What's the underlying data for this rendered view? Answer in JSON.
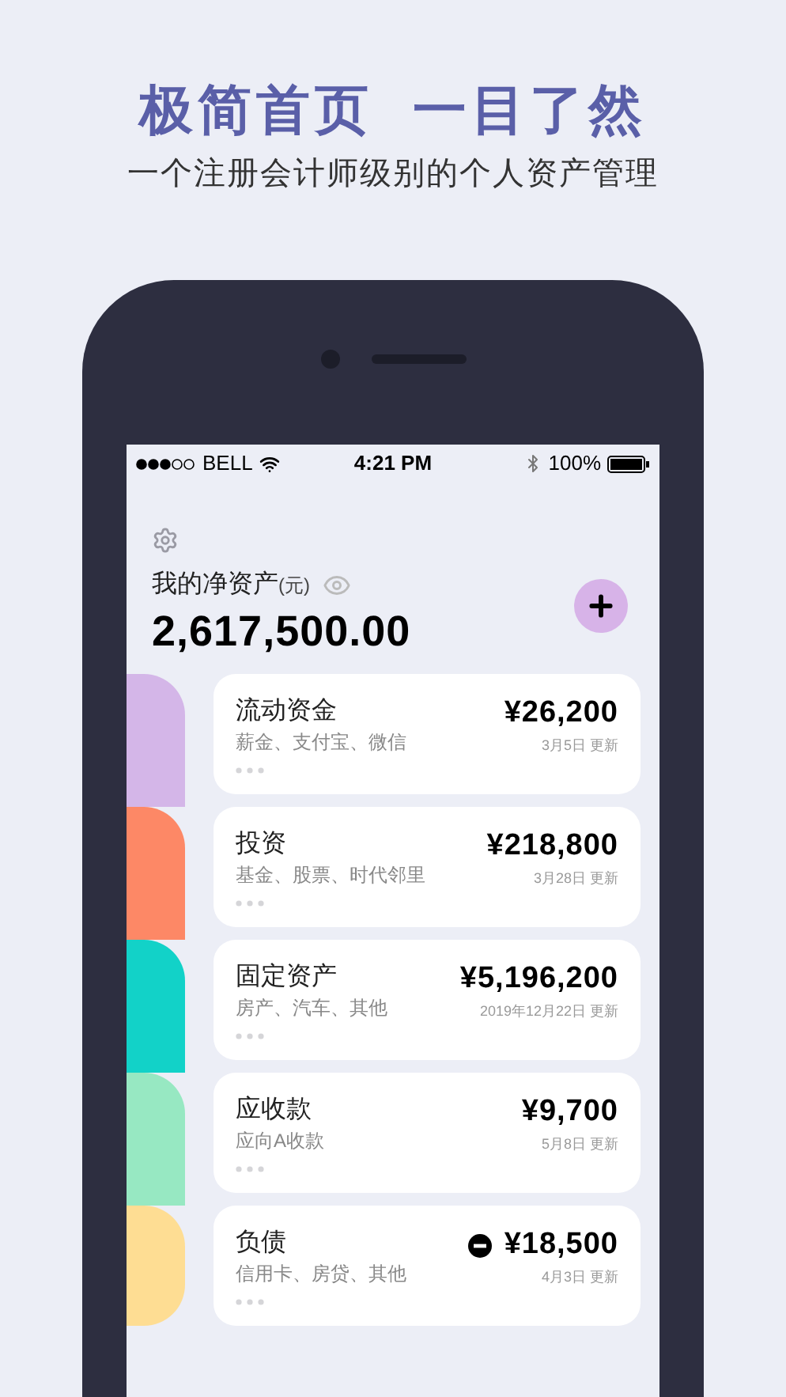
{
  "headline": "极简首页  一目了然",
  "subheadline": "一个注册会计师级别的个人资产管理",
  "status_bar": {
    "carrier": "BELL",
    "time": "4:21 PM",
    "battery": "100%"
  },
  "net_worth": {
    "label": "我的净资产",
    "unit": "(元)",
    "amount": "2,617,500.00"
  },
  "categories": [
    {
      "name": "流动资金",
      "details": "薪金、支付宝、微信",
      "amount": "¥26,200",
      "updated": "3月5日 更新",
      "color": "#d4b6e8",
      "negative": false
    },
    {
      "name": "投资",
      "details": "基金、股票、时代邻里",
      "amount": "¥218,800",
      "updated": "3月28日 更新",
      "color": "#fd8866",
      "negative": false
    },
    {
      "name": "固定资产",
      "details": "房产、汽车、其他",
      "amount": "¥5,196,200",
      "updated": "2019年12月22日 更新",
      "color": "#12d2c8",
      "negative": false
    },
    {
      "name": "应收款",
      "details": "应向A收款",
      "amount": "¥9,700",
      "updated": "5月8日 更新",
      "color": "#97e8c2",
      "negative": false
    },
    {
      "name": "负债",
      "details": "信用卡、房贷、其他",
      "amount": "¥18,500",
      "updated": "4月3日 更新",
      "color": "#fedd93",
      "negative": true
    }
  ]
}
